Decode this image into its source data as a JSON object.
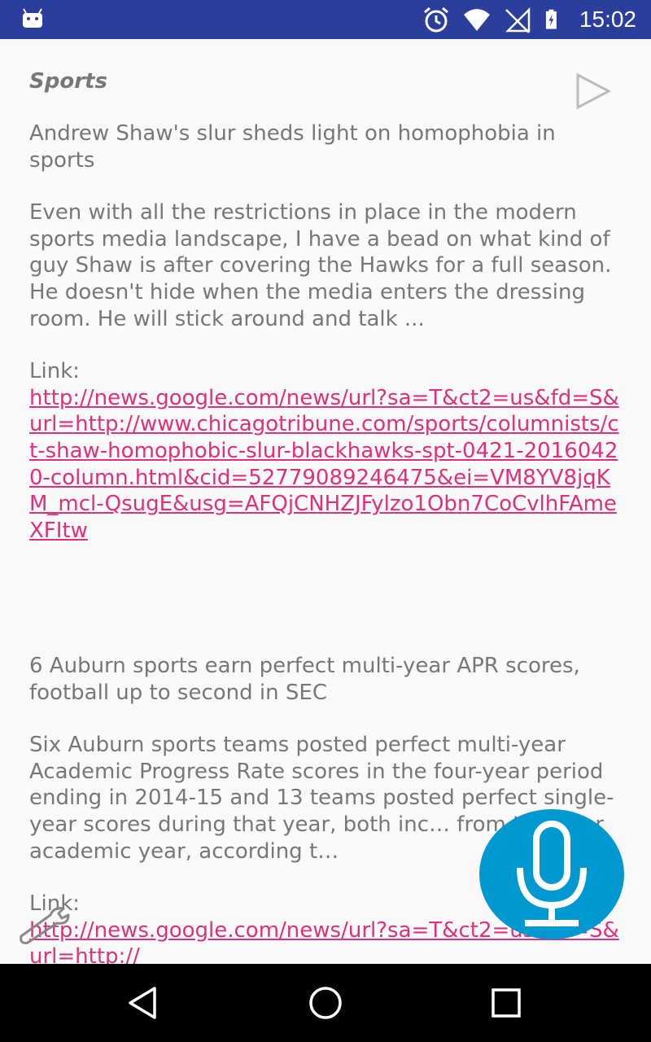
{
  "status_bar": {
    "time": "15:02",
    "icons": [
      "android-icon",
      "alarm-icon",
      "wifi-icon",
      "no-sim-icon",
      "battery-charging-icon"
    ]
  },
  "section": {
    "title": "Sports",
    "play_icon": "play-icon"
  },
  "articles": [
    {
      "title": "Andrew Shaw's slur sheds light on homophobia in sports",
      "body": "Even with all the restrictions in place in the modern sports media landscape, I have a bead on what kind of guy Shaw is after covering the Hawks for a full season. He doesn't hide when the media enters the dressing room. He will stick around and talk ...",
      "link_label": "Link:",
      "link": "http://news.google.com/news/url?sa=T&ct2=us&fd=S&url=http://www.chicagotribune.com/sports/columnists/ct-shaw-homophobic-slur-blackhawks-spt-0421-20160420-column.html&cid=52779089246475&ei=VM8YV8jqKM_mcl-QsugE&usg=AFQjCNHZJFylzo1Obn7CoCvlhFAmeXFItw"
    },
    {
      "title": "6 Auburn sports earn perfect multi-year APR scores, football up to second in SEC",
      "body": "Six Auburn sports teams posted perfect multi-year Academic Progress Rate scores in the four-year period ending in 2014-15 and 13 teams posted perfect single-year scores during that year, both inc… from the prior academic year, according t…",
      "link_label": "Link:",
      "link": "http://news.google.com/news/url?sa=T&ct2=us&fd=S&url=http://"
    }
  ],
  "overlays": {
    "mic_icon": "microphone-icon",
    "wrench_icon": "wrench-icon"
  },
  "nav_bar": {
    "icons": [
      "back-icon",
      "home-icon",
      "recents-icon"
    ]
  },
  "colors": {
    "status_bar": "#2c3e9c",
    "link": "#e0307a",
    "mic_fab": "#0098cf",
    "text": "#777777"
  }
}
